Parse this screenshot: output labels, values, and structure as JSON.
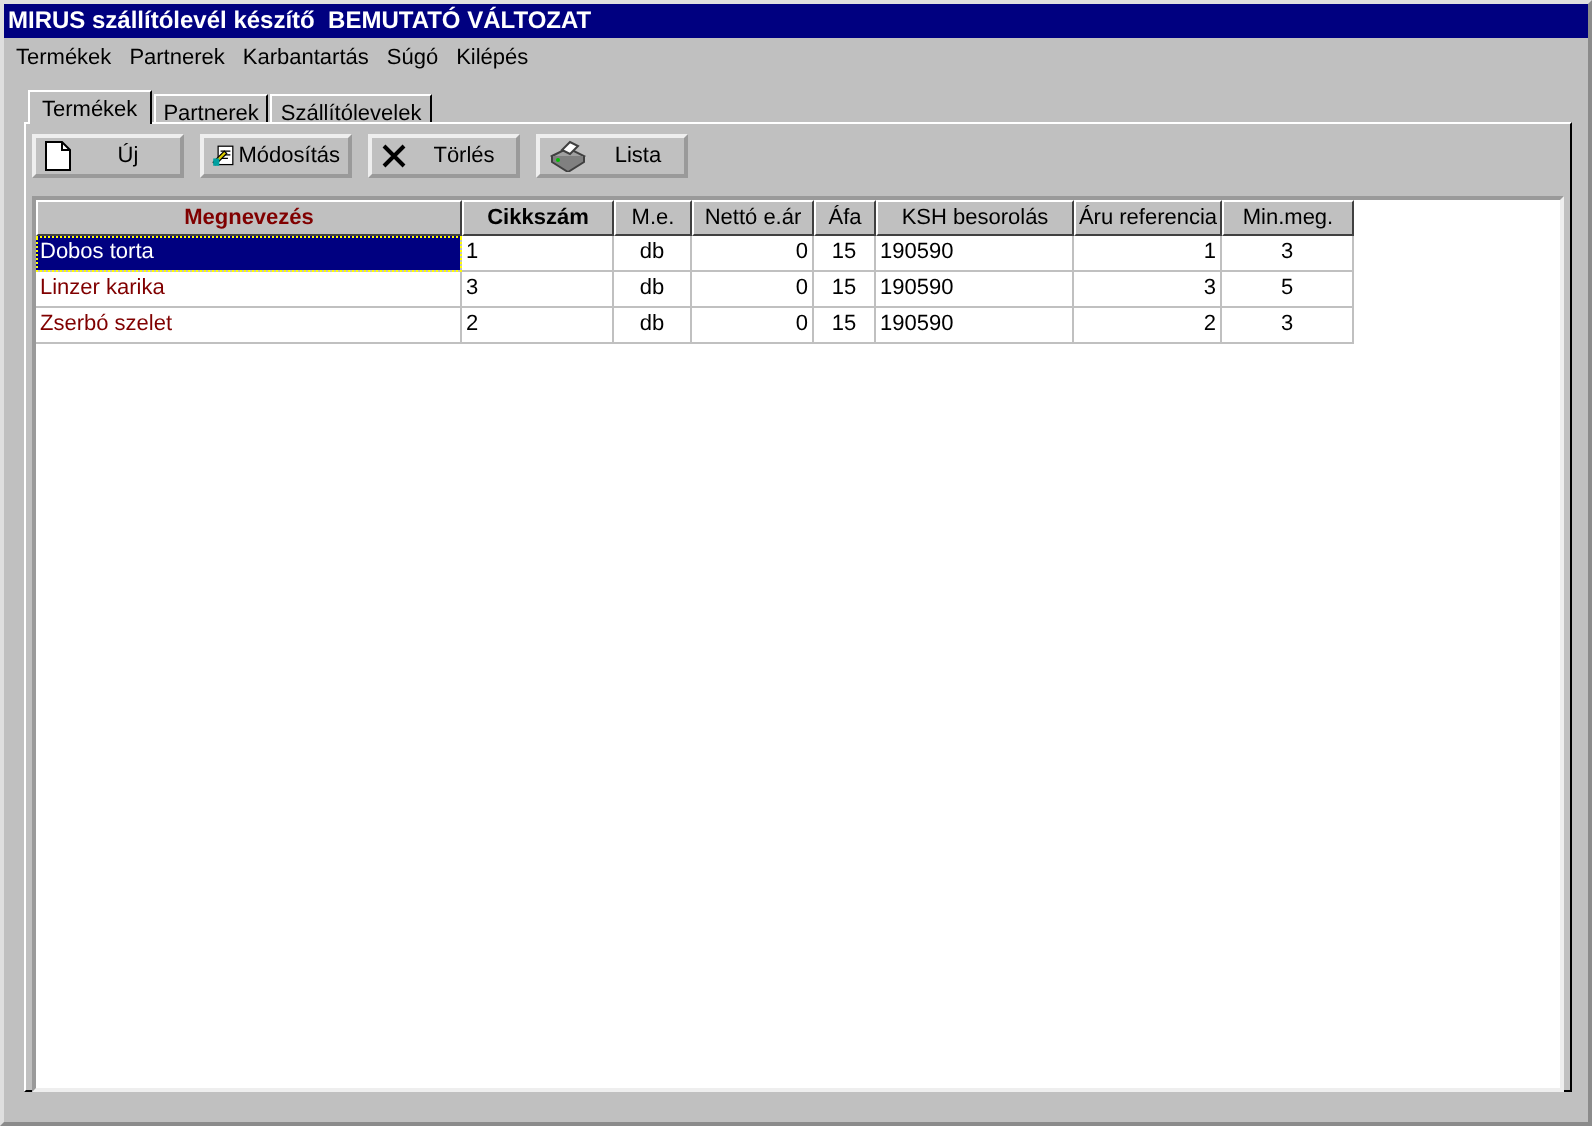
{
  "window": {
    "title": "MIRUS szállítólevél készítő  BEMUTATÓ VÁLTOZAT"
  },
  "menu": [
    "Termékek",
    "Partnerek",
    "Karbantartás",
    "Súgó",
    "Kilépés"
  ],
  "tabs": [
    {
      "label": "Termékek",
      "selected": true
    },
    {
      "label": "Partnerek",
      "selected": false
    },
    {
      "label": "Szállítólevelek",
      "selected": false
    }
  ],
  "toolbar": [
    {
      "label": "Új"
    },
    {
      "label": "Módosítás"
    },
    {
      "label": "Törlés"
    },
    {
      "label": "Lista"
    }
  ],
  "table": {
    "columns": [
      {
        "label": "Megnevezés",
        "kind": "key"
      },
      {
        "label": "Cikkszám",
        "kind": "bold"
      },
      {
        "label": "M.e.",
        "kind": "plain"
      },
      {
        "label": "Nettó e.ár",
        "kind": "plain"
      },
      {
        "label": "Áfa",
        "kind": "plain"
      },
      {
        "label": "KSH besorolás",
        "kind": "plain"
      },
      {
        "label": "Áru  referencia",
        "kind": "plain"
      },
      {
        "label": "Min.meg.",
        "kind": "plain"
      }
    ],
    "rows": [
      {
        "selected": true,
        "cells": [
          "Dobos torta",
          "1",
          "db",
          "0",
          "15",
          "190590",
          "1",
          "3"
        ]
      },
      {
        "selected": false,
        "cells": [
          "Linzer karika",
          "3",
          "db",
          "0",
          "15",
          "190590",
          "3",
          "5"
        ]
      },
      {
        "selected": false,
        "cells": [
          "Zserbó szelet",
          "2",
          "db",
          "0",
          "15",
          "190590",
          "2",
          "3"
        ]
      }
    ]
  }
}
